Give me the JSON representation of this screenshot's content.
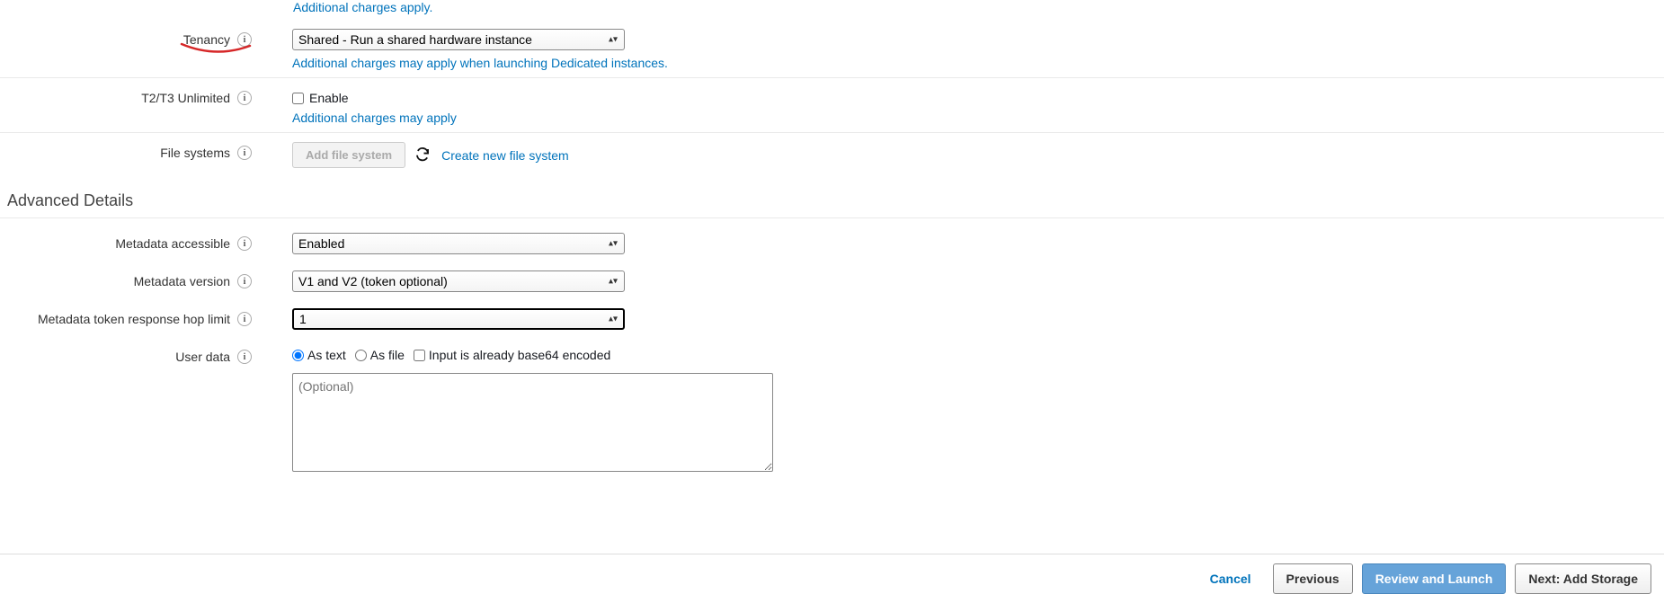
{
  "partial_top_link": "Additional charges apply.",
  "tenancy": {
    "label": "Tenancy",
    "selected": "Shared - Run a shared hardware instance",
    "help_link": "Additional charges may apply when launching Dedicated instances."
  },
  "t2t3": {
    "label": "T2/T3 Unlimited",
    "checkbox_label": "Enable",
    "help_link": "Additional charges may apply"
  },
  "filesystems": {
    "label": "File systems",
    "add_button": "Add file system",
    "create_link": "Create new file system"
  },
  "advanced_section": "Advanced Details",
  "metadata_accessible": {
    "label": "Metadata accessible",
    "selected": "Enabled"
  },
  "metadata_version": {
    "label": "Metadata version",
    "selected": "V1 and V2 (token optional)"
  },
  "metadata_hop": {
    "label": "Metadata token response hop limit",
    "selected": "1"
  },
  "user_data": {
    "label": "User data",
    "as_text": "As text",
    "as_file": "As file",
    "base64": "Input is already base64 encoded",
    "placeholder": "(Optional)"
  },
  "footer": {
    "cancel": "Cancel",
    "previous": "Previous",
    "review": "Review and Launch",
    "next": "Next: Add Storage"
  }
}
